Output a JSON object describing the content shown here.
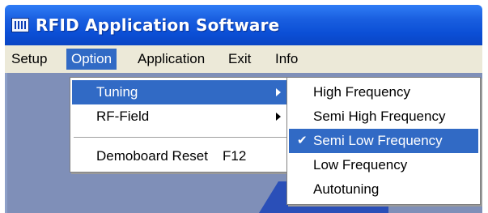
{
  "window": {
    "title": "RFID Application Software",
    "icon": "app-logo-icon"
  },
  "menubar": {
    "items": [
      {
        "label": "Setup"
      },
      {
        "label": "Option"
      },
      {
        "label": "Application"
      },
      {
        "label": "Exit"
      },
      {
        "label": "Info"
      }
    ]
  },
  "option_menu": {
    "items": [
      {
        "label": "Tuning",
        "submenu": true
      },
      {
        "label": "RF-Field",
        "submenu": true
      },
      {
        "label": "Demoboard Reset",
        "shortcut": "F12"
      }
    ]
  },
  "tuning_menu": {
    "items": [
      {
        "label": "High Frequency"
      },
      {
        "label": "Semi High Frequency"
      },
      {
        "label": "Semi Low Frequency",
        "checked": true,
        "check_icon": "✔"
      },
      {
        "label": "Low Frequency"
      },
      {
        "label": "Autotuning"
      }
    ]
  },
  "colors": {
    "highlight": "#316ac5",
    "titlebar": "#0b4fd6",
    "menubar": "#ece9d8"
  }
}
